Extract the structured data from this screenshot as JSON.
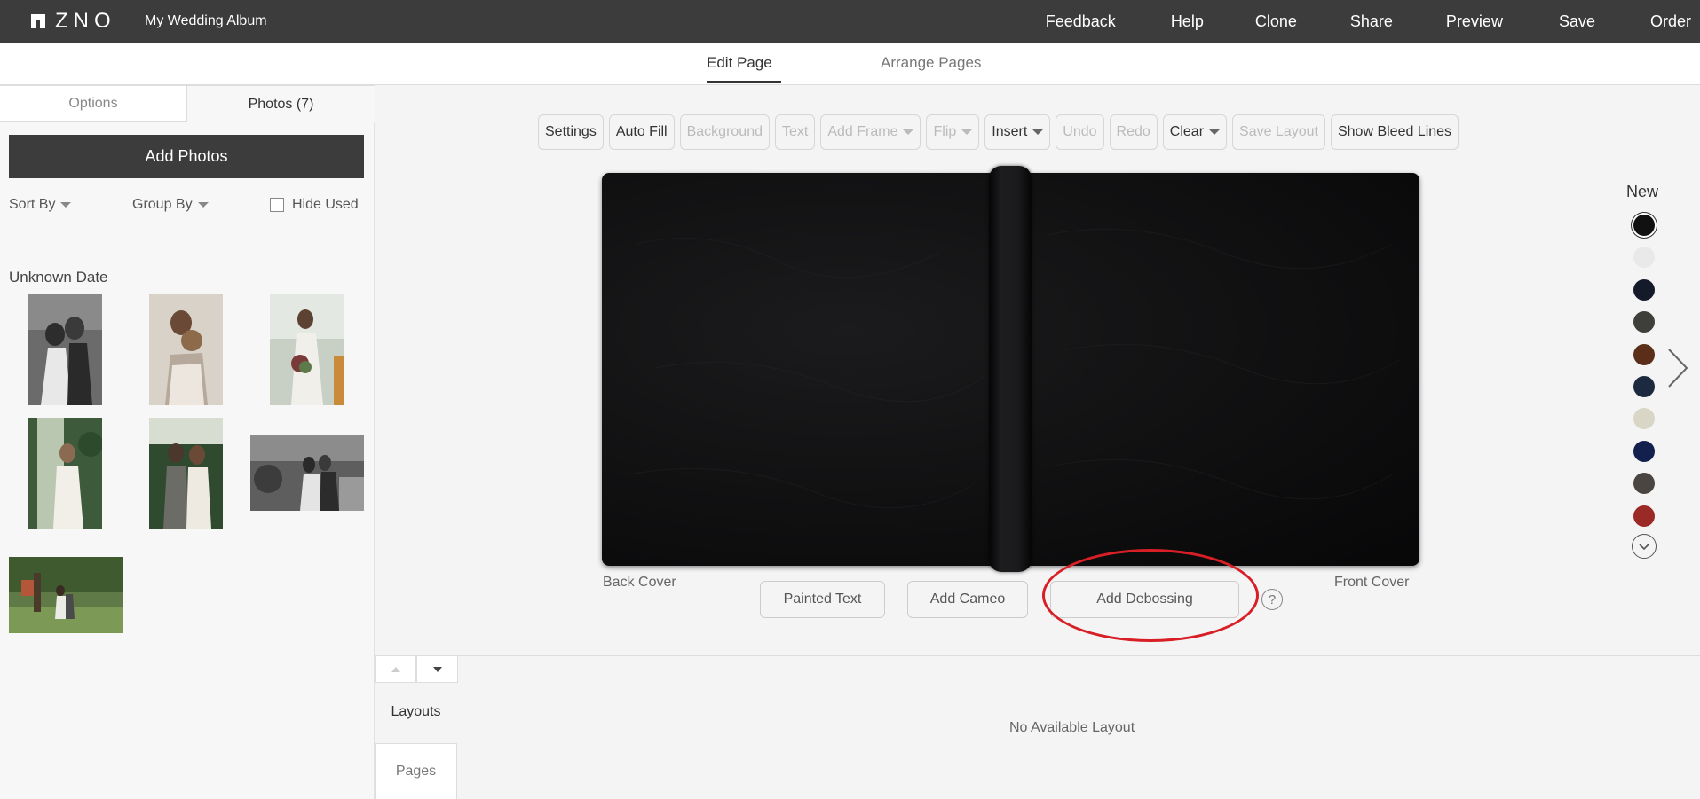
{
  "app": {
    "logo_text": "ZNO",
    "album_title": "My Wedding Album"
  },
  "topnav": {
    "items": [
      "Feedback",
      "Help",
      "Clone",
      "Share",
      "Preview",
      "Save",
      "Order"
    ]
  },
  "subtabs": {
    "edit_page": "Edit Page",
    "arrange_pages": "Arrange Pages",
    "active": "Edit Page"
  },
  "sidebar": {
    "tabs": {
      "options": "Options",
      "photos": "Photos (7)",
      "active": "Photos (7)"
    },
    "add_photos": "Add Photos",
    "sort_by": "Sort By",
    "group_by": "Group By",
    "hide_used": "Hide Used",
    "hide_used_checked": false,
    "date_group": "Unknown Date",
    "photos": [
      {
        "name": "couple-embrace-bw"
      },
      {
        "name": "couple-forehead-touch"
      },
      {
        "name": "bride-bouquet-greenhouse"
      },
      {
        "name": "bride-greenhouse-plants"
      },
      {
        "name": "couple-walking-greenhouse"
      },
      {
        "name": "couple-seated-bw"
      },
      {
        "name": "couple-under-tree"
      }
    ]
  },
  "toolbar": {
    "buttons": [
      {
        "label": "Settings",
        "enabled": true,
        "dropdown": false
      },
      {
        "label": "Auto Fill",
        "enabled": true,
        "dropdown": false
      },
      {
        "label": "Background",
        "enabled": false,
        "dropdown": false
      },
      {
        "label": "Text",
        "enabled": false,
        "dropdown": false
      },
      {
        "label": "Add Frame",
        "enabled": false,
        "dropdown": true
      },
      {
        "label": "Flip",
        "enabled": false,
        "dropdown": true
      },
      {
        "label": "Insert",
        "enabled": true,
        "dropdown": true
      },
      {
        "label": "Undo",
        "enabled": false,
        "dropdown": false
      },
      {
        "label": "Redo",
        "enabled": false,
        "dropdown": false
      },
      {
        "label": "Clear",
        "enabled": true,
        "dropdown": true
      },
      {
        "label": "Save Layout",
        "enabled": false,
        "dropdown": false
      },
      {
        "label": "Show Bleed Lines",
        "enabled": true,
        "dropdown": false
      }
    ]
  },
  "canvas": {
    "back_cover": "Back Cover",
    "front_cover": "Front Cover",
    "painted_text": "Painted Text",
    "add_cameo": "Add Cameo",
    "add_debossing": "Add Debossing",
    "help": "?"
  },
  "swatches": {
    "label": "New",
    "colors": [
      "#111111",
      "#e9e9e9",
      "#141a2a",
      "#3e3e3a",
      "#5a2e18",
      "#1c2a40",
      "#d9d6c5",
      "#13204e",
      "#4a4540",
      "#9a2a26"
    ],
    "selected_index": 0
  },
  "bottom": {
    "layouts_tab": "Layouts",
    "pages_tab": "Pages",
    "empty_message": "No Available Layout"
  },
  "colors": {
    "topbar": "#3c3c3c",
    "highlight": "#d81f26"
  }
}
